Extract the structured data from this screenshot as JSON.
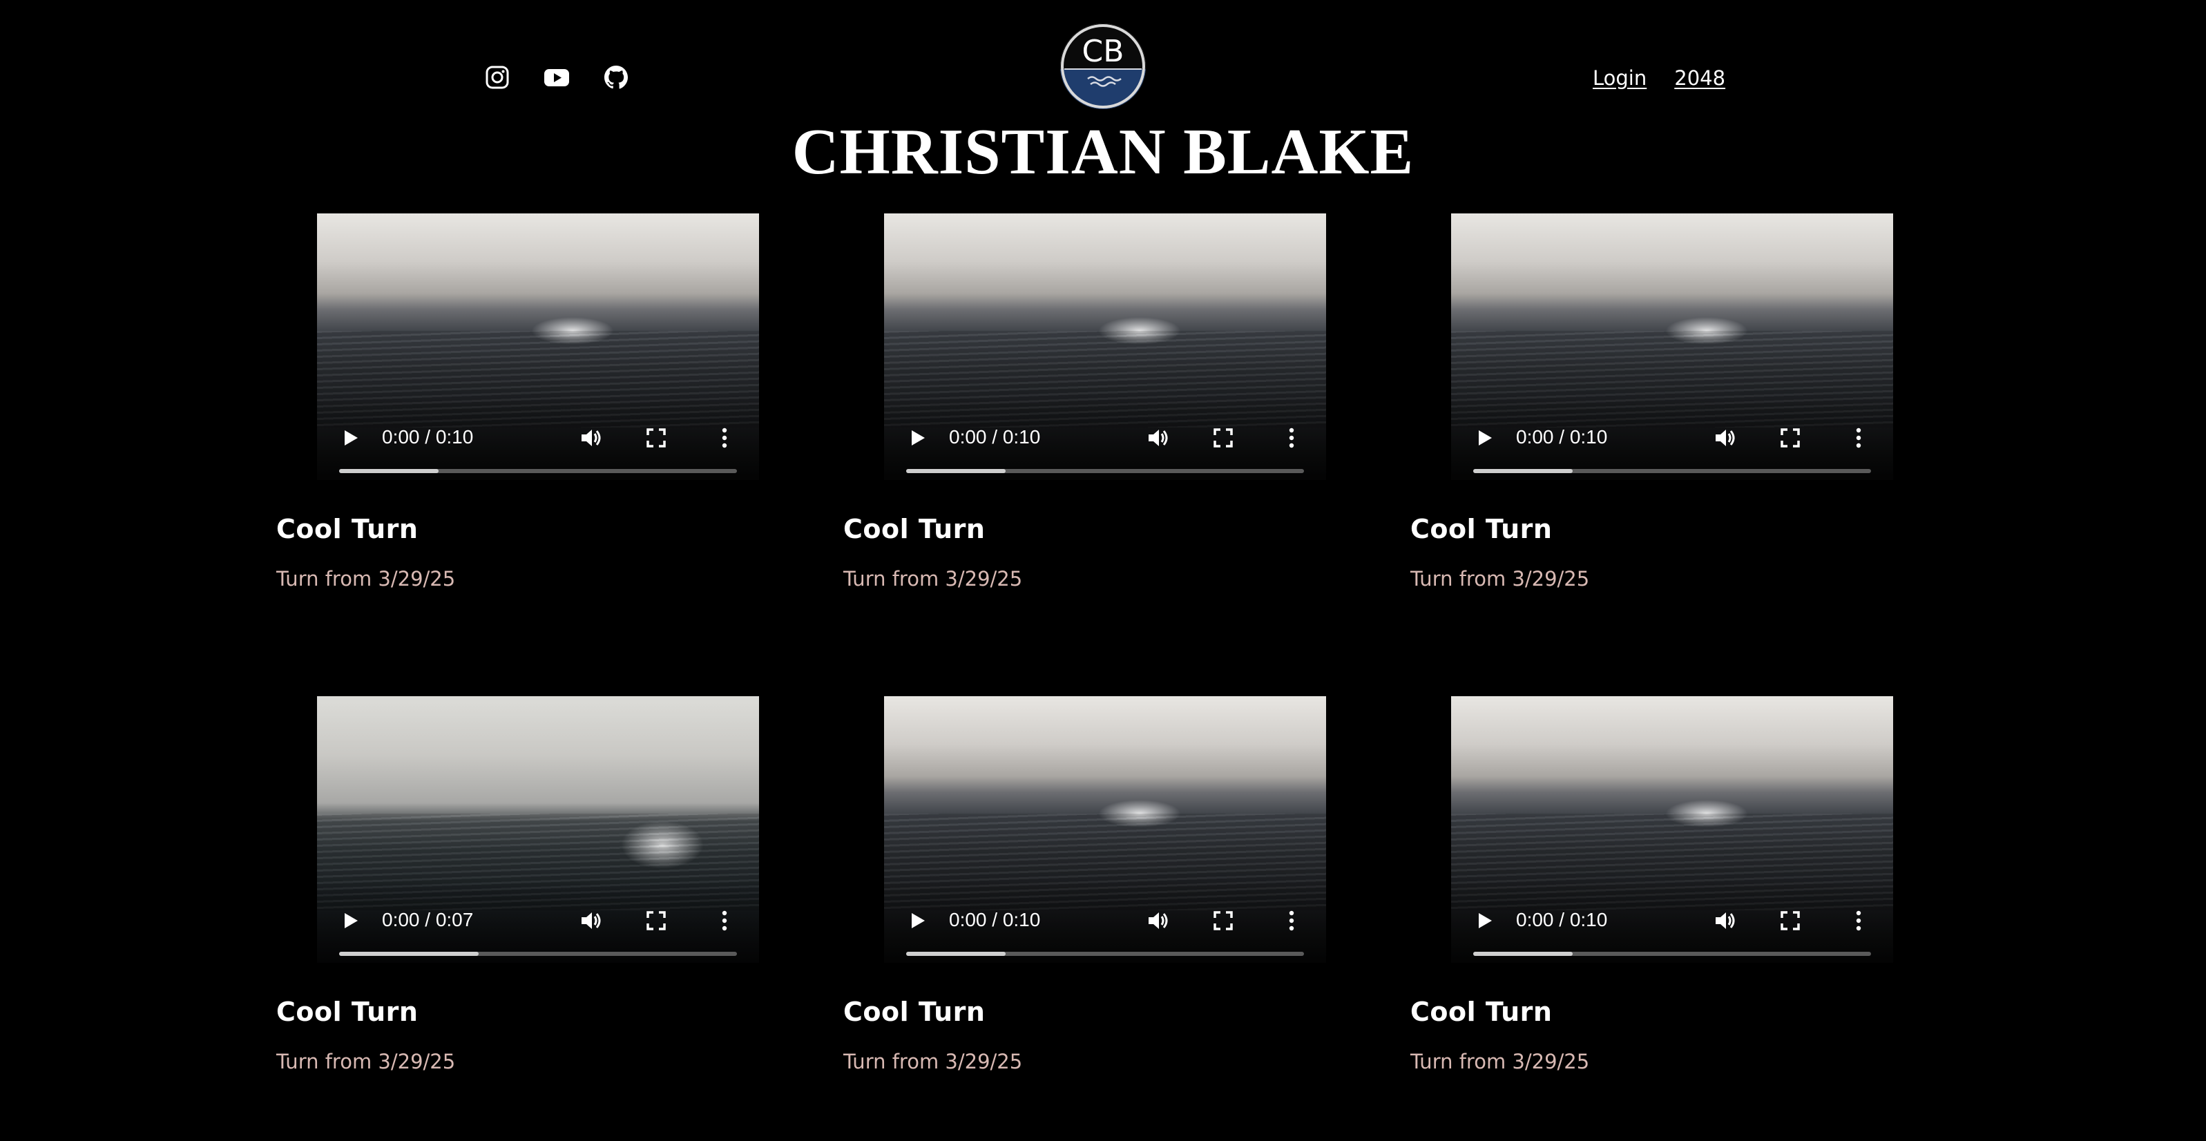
{
  "header": {
    "site_title": "CHRISTIAN BLAKE",
    "logo_initials": "CB",
    "social_icons": [
      "instagram-icon",
      "youtube-icon",
      "github-icon"
    ],
    "links": [
      {
        "label": "Login"
      },
      {
        "label": "2048"
      }
    ]
  },
  "colors": {
    "background": "#000000",
    "subtitle": "#d8b9b3",
    "logo_water": "#1f3d6d"
  },
  "cards": [
    {
      "title": "Cool Turn",
      "subtitle": "Turn from 3/29/25",
      "time": "0:00 / 0:10",
      "buffered": 0.25
    },
    {
      "title": "Cool Turn",
      "subtitle": "Turn from 3/29/25",
      "time": "0:00 / 0:10",
      "buffered": 0.25
    },
    {
      "title": "Cool Turn",
      "subtitle": "Turn from 3/29/25",
      "time": "0:00 / 0:10",
      "buffered": 0.25
    },
    {
      "title": "Cool Turn",
      "subtitle": "Turn from 3/29/25",
      "time": "0:00 / 0:07",
      "buffered": 0.35
    },
    {
      "title": "Cool Turn",
      "subtitle": "Turn from 3/29/25",
      "time": "0:00 / 0:10",
      "buffered": 0.25
    },
    {
      "title": "Cool Turn",
      "subtitle": "Turn from 3/29/25",
      "time": "0:00 / 0:10",
      "buffered": 0.25
    }
  ]
}
